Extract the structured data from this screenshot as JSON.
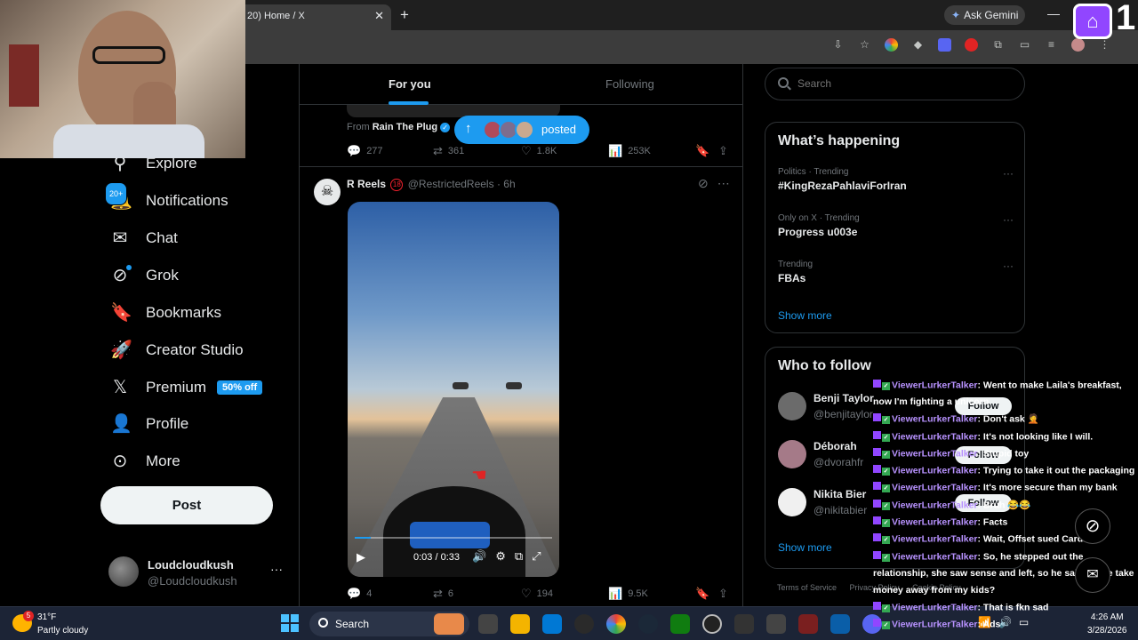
{
  "browser": {
    "tab_title": "20) Home / X",
    "tab_close": "✕",
    "new_tab": "+",
    "gemini_label": "Ask Gemini",
    "minimize": "—"
  },
  "overlay": {
    "twitch_count": "1"
  },
  "sidebar": {
    "items": [
      {
        "label": "Explore",
        "icon": "explore-icon"
      },
      {
        "label": "Notifications",
        "icon": "bell-icon",
        "badge": "20+"
      },
      {
        "label": "Chat",
        "icon": "mail-icon"
      },
      {
        "label": "Grok",
        "icon": "grok-icon"
      },
      {
        "label": "Bookmarks",
        "icon": "bookmark-icon"
      },
      {
        "label": "Creator Studio",
        "icon": "rocket-icon"
      },
      {
        "label": "Premium",
        "icon": "x-logo-icon",
        "badge": "50% off"
      },
      {
        "label": "Profile",
        "icon": "person-icon"
      },
      {
        "label": "More",
        "icon": "more-circle-icon"
      }
    ],
    "post_label": "Post",
    "account_name": "Loudcloudkush",
    "account_handle": "@Loudcloudkush",
    "account_more": "···"
  },
  "timeline": {
    "tabs": [
      "For you",
      "Following"
    ],
    "from_prefix": "From",
    "from_name": "Rain The Plug",
    "posted_label": "posted",
    "tweet1_actions": {
      "replies": "277",
      "reposts": "361",
      "likes": "1.8K",
      "views": "253K"
    },
    "tweet2": {
      "name": "R Reels",
      "age_badge": "18",
      "handle": "@RestrictedReels",
      "time": "· 6h"
    },
    "video": {
      "time": "0:03 / 0:33",
      "progress": 0.08
    },
    "tweet2_actions": {
      "replies": "4",
      "reposts": "6",
      "likes": "194",
      "views": "9.5K"
    }
  },
  "right": {
    "search_placeholder": "Search",
    "happening_title": "What’s happening",
    "trends": [
      {
        "meta": "Politics · Trending",
        "name": "#KingRezaPahlaviForIran"
      },
      {
        "meta": "Only on X · Trending",
        "name": "Progress u003e"
      },
      {
        "meta": "Trending",
        "name": "FBAs"
      }
    ],
    "show_more": "Show more",
    "who_title": "Who to follow",
    "follows": [
      {
        "name": "Benji Taylor",
        "handle": "@benjitaylor",
        "color": "#6b6b6b"
      },
      {
        "name": "Déborah",
        "handle": "@dvorahfr",
        "color": "#a57a88"
      },
      {
        "name": "Nikita Bier",
        "handle": "@nikitabier",
        "color": "#f0f0f0"
      }
    ],
    "follow_label": "Follow",
    "footer": [
      "Terms of Service",
      "Privacy Policy",
      "Cookie Policy"
    ]
  },
  "chat": {
    "messages": [
      {
        "user": "ViewerLurkerTalker",
        "text": ": Went to make Laila's breakfast, now I'm fighting a unicorn"
      },
      {
        "user": "ViewerLurkerTalker",
        "text": ": Don't ask 🤦"
      },
      {
        "user": "ViewerLurkerTalker",
        "text": ": It's not looking like I will."
      },
      {
        "user": "ViewerLurkerTalker",
        "text": ": Stupid toy"
      },
      {
        "user": "ViewerLurkerTalker",
        "text": ": Trying to take it out the packaging"
      },
      {
        "user": "ViewerLurkerTalker",
        "text": ": It's more secure than my bank"
      },
      {
        "user": "ViewerLurkerTalker",
        "text": ": Bruh 😂😂"
      },
      {
        "user": "ViewerLurkerTalker",
        "text": ": Facts"
      },
      {
        "user": "ViewerLurkerTalker",
        "text": ": Wait, Offset sued Cardi ¿"
      },
      {
        "user": "ViewerLurkerTalker",
        "text": ": So, he stepped out the relationship, she saw sense and left, so he said let me take money away from my kids?"
      },
      {
        "user": "ViewerLurkerTalker",
        "text": ": That is fkn sad"
      },
      {
        "user": "ViewerLurkerTalker",
        "text": ": Ads"
      }
    ]
  },
  "taskbar": {
    "weather_alert": "5",
    "weather_temp": "31°F",
    "weather_desc": "Partly cloudy",
    "search_label": "Search",
    "time": "4:26 AM",
    "date": "3/28/2026"
  }
}
